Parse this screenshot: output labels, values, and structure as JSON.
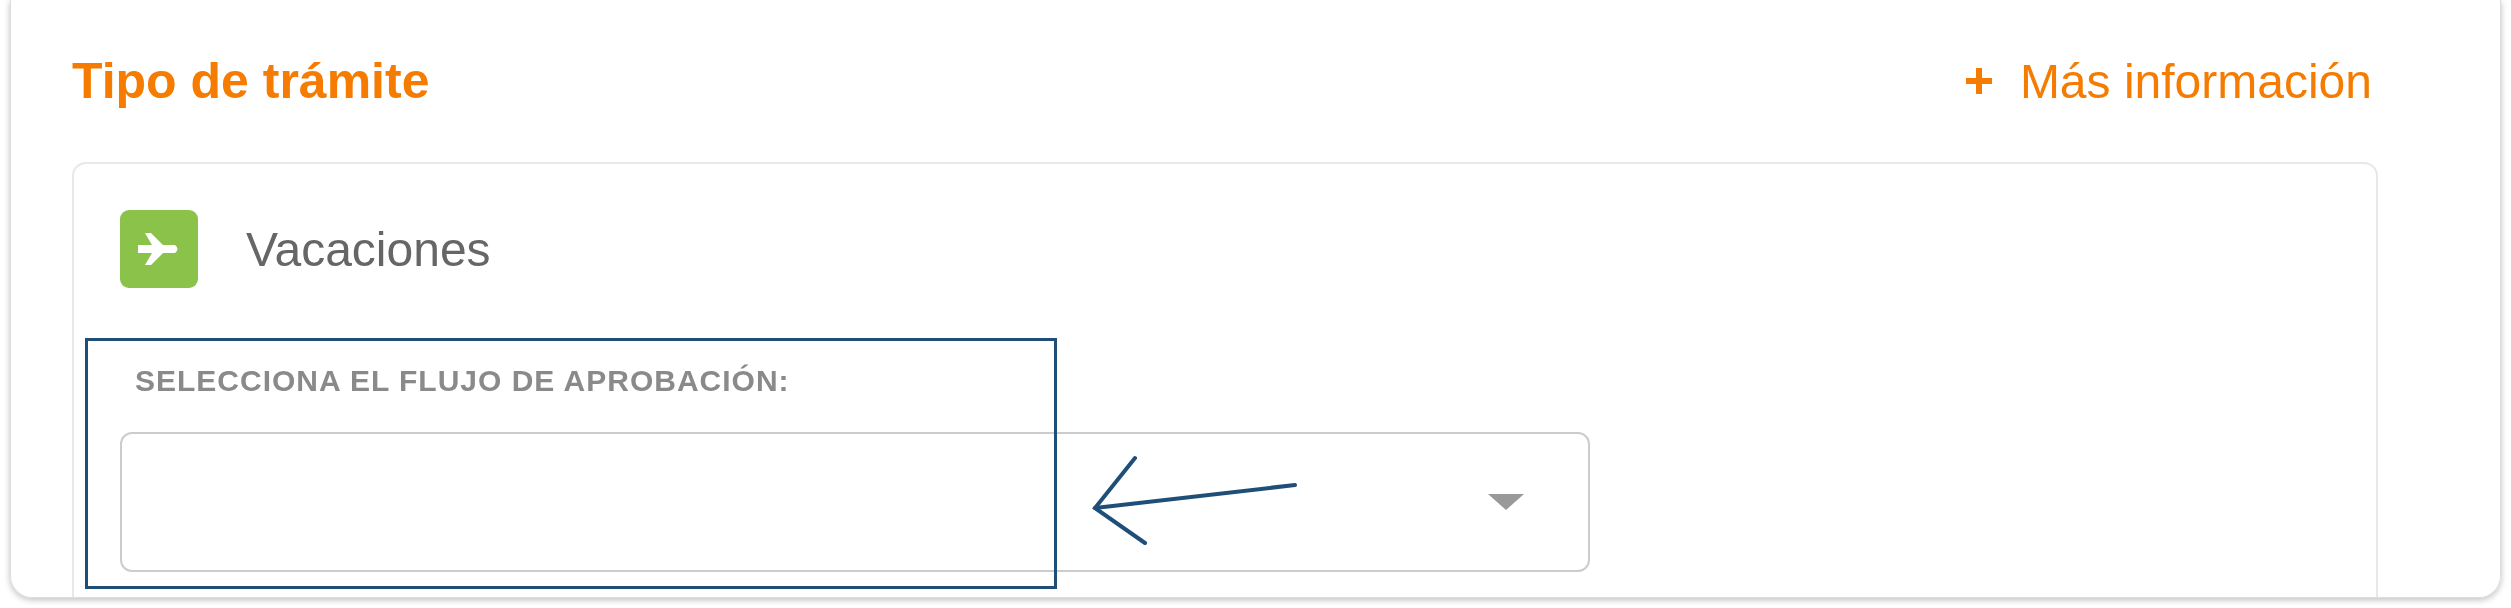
{
  "section": {
    "title": "Tipo de trámite",
    "more_info": "Más información"
  },
  "procedure": {
    "name": "Vacaciones",
    "field_label": "SELECCIONA EL FLUJO DE APROBACIÓN:"
  }
}
